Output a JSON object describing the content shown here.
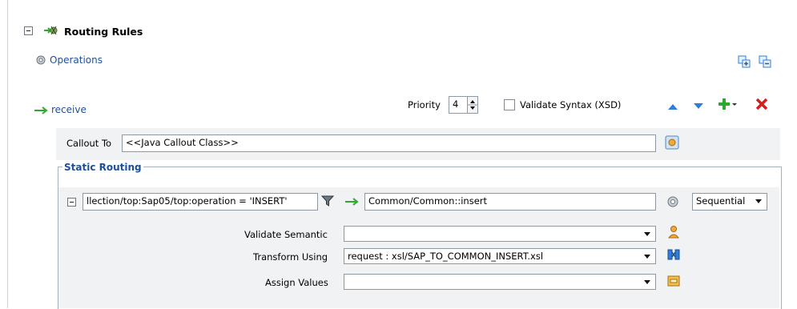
{
  "header": {
    "title": "Routing Rules",
    "operations_label": "Operations"
  },
  "route": {
    "name": "receive",
    "priority_label": "Priority",
    "priority_value": "4",
    "validate_syntax_label": "Validate Syntax (XSD)",
    "validate_syntax_checked": false
  },
  "callout": {
    "label": "Callout To",
    "value": "<<Java Callout Class>>"
  },
  "static_routing": {
    "title": "Static Routing",
    "filter_expression": "llection/top:Sap05/top:operation = 'INSERT'",
    "target_service": "Common/Common::insert",
    "mode_value": "Sequential",
    "validate_semantic_label": "Validate Semantic",
    "validate_semantic_value": "",
    "transform_using_label": "Transform Using",
    "transform_using_value": "request : xsl/SAP_TO_COMMON_INSERT.xsl",
    "assign_values_label": "Assign Values",
    "assign_values_value": ""
  },
  "icons": {
    "routing": "routing-rules-icon",
    "operations": "gear-icon",
    "expand_all": "expand-all-icon",
    "collapse_all": "collapse-all-icon",
    "arrow": "green-arrow-icon",
    "move_up": "move-up-icon",
    "move_down": "move-down-icon",
    "add": "add-icon",
    "delete": "delete-icon",
    "filter": "filter-icon",
    "callout_browse": "browse-icon",
    "service_options": "gear-icon",
    "semantic": "validate-semantic-icon",
    "transform": "transform-icon",
    "assign": "assign-values-icon"
  },
  "colors": {
    "link": "#1e4f9a",
    "green": "#2ea82e",
    "red": "#d3201b",
    "blue": "#2f7fd6",
    "border": "#8e98a3"
  }
}
